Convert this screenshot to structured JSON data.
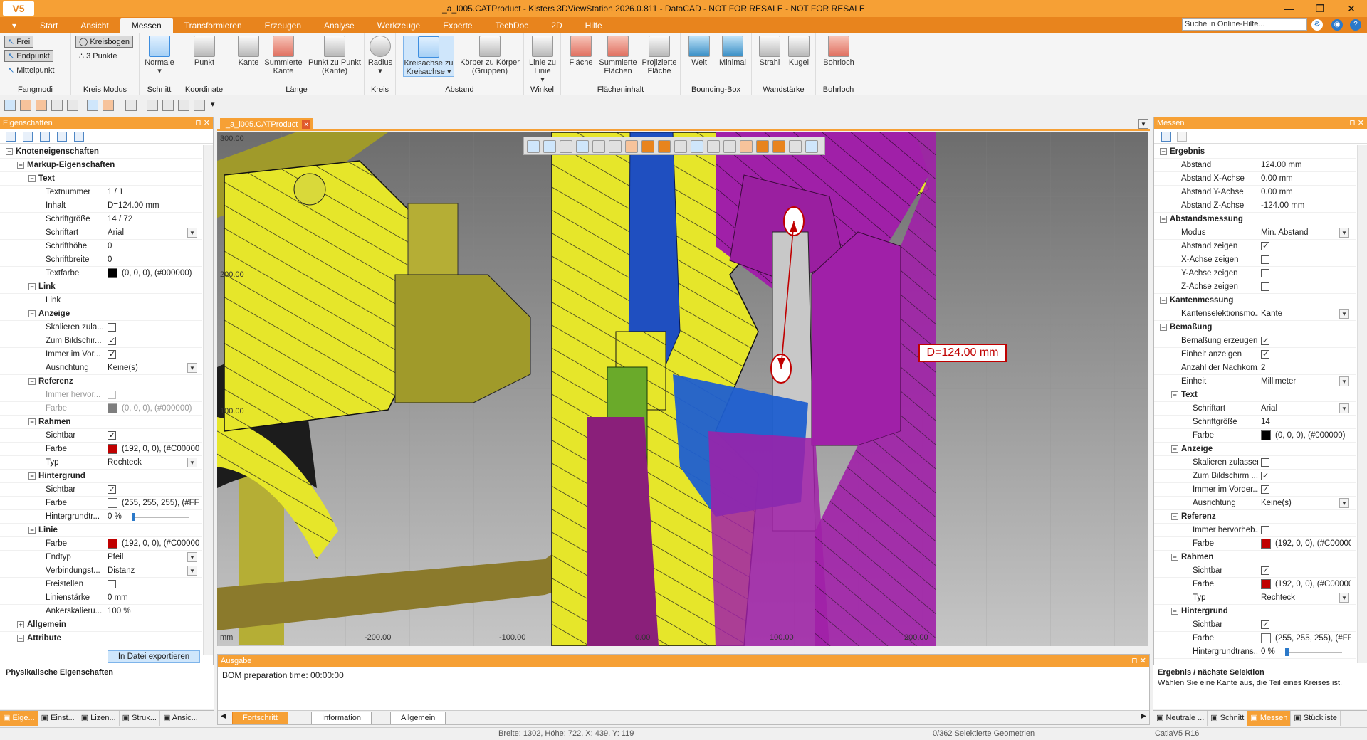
{
  "titlebar": {
    "logo": "V5",
    "title": "_a_l005.CATProduct - Kisters 3DViewStation 2026.0.811 - DataCAD - NOT FOR RESALE - NOT FOR RESALE",
    "minimize": "—",
    "restore": "❐",
    "close": "✕"
  },
  "menubar": {
    "drop": "▾",
    "tabs": [
      "Start",
      "Ansicht",
      "Messen",
      "Transformieren",
      "Erzeugen",
      "Analyse",
      "Werkzeuge",
      "Experte",
      "TechDoc",
      "2D",
      "Hilfe"
    ],
    "active_tab": "Messen",
    "help_search_placeholder": "Suche in Online-Hilfe..."
  },
  "ribbon": {
    "fangmodi": {
      "label": "Fangmodi",
      "items": [
        "Frei",
        "Endpunkt",
        "Mittelpunkt"
      ]
    },
    "kreismodus": {
      "label": "Kreis Modus",
      "items": [
        "Kreisbogen",
        "3 Punkte"
      ]
    },
    "schnitt": {
      "label": "Schnitt",
      "button": "Normale"
    },
    "koordinate": {
      "label": "Koordinate",
      "button": "Punkt"
    },
    "laenge": {
      "label": "Länge",
      "buttons": [
        "Kante",
        "Summierte Kante",
        "Punkt zu Punkt (Kante)"
      ]
    },
    "kreis": {
      "label": "Kreis",
      "button": "Radius"
    },
    "abstand": {
      "label": "Abstand",
      "buttons": [
        "Kreisachse zu Kreisachse",
        "Körper zu Körper (Gruppen)"
      ]
    },
    "winkel": {
      "label": "Winkel",
      "button": "Linie zu Linie"
    },
    "flaecheninhalt": {
      "label": "Flächeninhalt",
      "buttons": [
        "Fläche",
        "Summierte Flächen",
        "Projizierte Fläche"
      ]
    },
    "boundingbox": {
      "label": "Bounding-Box",
      "buttons": [
        "Welt",
        "Minimal"
      ]
    },
    "wandstaerke": {
      "label": "Wandstärke",
      "buttons": [
        "Strahl",
        "Kugel"
      ]
    },
    "bohrloch": {
      "label": "Bohrloch",
      "button": "Bohrloch"
    }
  },
  "left_panel": {
    "title": "Eigenschaften",
    "rows": [
      {
        "level": 0,
        "type": "cat",
        "key": "Knoteneigenschaften",
        "exp": "−"
      },
      {
        "level": 1,
        "type": "cat",
        "key": "Markup-Eigenschaften",
        "exp": "−"
      },
      {
        "level": 2,
        "type": "cat",
        "key": "Text",
        "exp": "−"
      },
      {
        "level": 3,
        "key": "Textnummer",
        "value": "1 / 1"
      },
      {
        "level": 3,
        "key": "Inhalt",
        "value": "D=124.00 mm"
      },
      {
        "level": 3,
        "key": "Schriftgröße",
        "value": "14 / 72"
      },
      {
        "level": 3,
        "key": "Schriftart",
        "value": "Arial",
        "dd": true
      },
      {
        "level": 3,
        "key": "Schrifthöhe",
        "value": "0"
      },
      {
        "level": 3,
        "key": "Schriftbreite",
        "value": "0"
      },
      {
        "level": 3,
        "key": "Textfarbe",
        "value": "(0, 0, 0), (#000000)",
        "swatch": "#000000"
      },
      {
        "level": 2,
        "type": "cat",
        "key": "Link",
        "exp": "−"
      },
      {
        "level": 3,
        "key": "Link",
        "value": ""
      },
      {
        "level": 2,
        "type": "cat",
        "key": "Anzeige",
        "exp": "−"
      },
      {
        "level": 3,
        "key": "Skalieren zula...",
        "check": false
      },
      {
        "level": 3,
        "key": "Zum Bildschir...",
        "check": true
      },
      {
        "level": 3,
        "key": "Immer im Vor...",
        "check": true
      },
      {
        "level": 3,
        "key": "Ausrichtung",
        "value": "Keine(s)",
        "dd": true
      },
      {
        "level": 2,
        "type": "cat",
        "key": "Referenz",
        "exp": "−"
      },
      {
        "level": 3,
        "key": "Immer hervor...",
        "check": false,
        "disabled": true
      },
      {
        "level": 3,
        "key": "Farbe",
        "value": "(0, 0, 0), (#000000)",
        "swatch": "#000000",
        "disabled": true
      },
      {
        "level": 2,
        "type": "cat",
        "key": "Rahmen",
        "exp": "−"
      },
      {
        "level": 3,
        "key": "Sichtbar",
        "check": true
      },
      {
        "level": 3,
        "key": "Farbe",
        "value": "(192, 0, 0), (#C00000",
        "swatch": "#c00000"
      },
      {
        "level": 3,
        "key": "Typ",
        "value": "Rechteck",
        "dd": true
      },
      {
        "level": 2,
        "type": "cat",
        "key": "Hintergrund",
        "exp": "−"
      },
      {
        "level": 3,
        "key": "Sichtbar",
        "check": true
      },
      {
        "level": 3,
        "key": "Farbe",
        "value": "(255, 255, 255), (#FFI",
        "swatch": "#ffffff"
      },
      {
        "level": 3,
        "key": "Hintergrundtr...",
        "value": "0 %",
        "slider": true
      },
      {
        "level": 2,
        "type": "cat",
        "key": "Linie",
        "exp": "−"
      },
      {
        "level": 3,
        "key": "Farbe",
        "value": "(192, 0, 0), (#C00000",
        "swatch": "#c00000"
      },
      {
        "level": 3,
        "key": "Endtyp",
        "value": "Pfeil",
        "dd": true
      },
      {
        "level": 3,
        "key": "Verbindungst...",
        "value": "Distanz",
        "dd": true
      },
      {
        "level": 3,
        "key": "Freistellen",
        "check": false
      },
      {
        "level": 3,
        "key": "Linienstärke",
        "value": "0 mm"
      },
      {
        "level": 3,
        "key": "Ankerskalieru...",
        "value": "100 %"
      },
      {
        "level": 1,
        "type": "cat",
        "key": "Allgemein",
        "exp": "+"
      },
      {
        "level": 1,
        "type": "cat",
        "key": "Attribute",
        "exp": "−"
      }
    ],
    "export_button": "In Datei exportieren",
    "bottom_title": "Physikalische Eigenschaften",
    "tabs": [
      "Eige...",
      "Einst...",
      "Lizen...",
      "Struk...",
      "Ansic..."
    ]
  },
  "viewport": {
    "doc_tab": "_a_l005.CATProduct",
    "dimension_label": "D=124.00 mm",
    "axis_labels": [
      "300.00",
      "200.00",
      "100.00",
      "mm",
      "-200.00",
      "-100.00",
      "0.00",
      "100.00",
      "200.00"
    ]
  },
  "output": {
    "title": "Ausgabe",
    "text": "BOM preparation time: 00:00:00",
    "tabs": [
      "Fortschritt",
      "Information",
      "Allgemein"
    ],
    "active_tab": "Fortschritt"
  },
  "right_panel": {
    "title": "Messen",
    "rows": [
      {
        "level": 0,
        "type": "cat",
        "key": "Ergebnis",
        "exp": "−"
      },
      {
        "level": 1,
        "key": "Abstand",
        "value": "124.00 mm"
      },
      {
        "level": 1,
        "key": "Abstand X-Achse",
        "value": "0.00 mm"
      },
      {
        "level": 1,
        "key": "Abstand Y-Achse",
        "value": "0.00 mm"
      },
      {
        "level": 1,
        "key": "Abstand Z-Achse",
        "value": "-124.00 mm"
      },
      {
        "level": 0,
        "type": "cat",
        "key": "Abstandsmessung",
        "exp": "−"
      },
      {
        "level": 1,
        "key": "Modus",
        "value": "Min. Abstand",
        "dd": true
      },
      {
        "level": 1,
        "key": "Abstand zeigen",
        "check": true
      },
      {
        "level": 1,
        "key": "X-Achse zeigen",
        "check": false
      },
      {
        "level": 1,
        "key": "Y-Achse zeigen",
        "check": false
      },
      {
        "level": 1,
        "key": "Z-Achse zeigen",
        "check": false
      },
      {
        "level": 0,
        "type": "cat",
        "key": "Kantenmessung",
        "exp": "−"
      },
      {
        "level": 1,
        "key": "Kantenselektionsmo...",
        "value": "Kante",
        "dd": true
      },
      {
        "level": 0,
        "type": "cat",
        "key": "Bemaßung",
        "exp": "−"
      },
      {
        "level": 1,
        "key": "Bemaßung erzeugen",
        "check": true
      },
      {
        "level": 1,
        "key": "Einheit anzeigen",
        "check": true
      },
      {
        "level": 1,
        "key": "Anzahl der Nachkom...",
        "value": "2"
      },
      {
        "level": 1,
        "key": "Einheit",
        "value": "Millimeter",
        "dd": true
      },
      {
        "level": 1,
        "type": "cat",
        "key": "Text",
        "exp": "−"
      },
      {
        "level": 2,
        "key": "Schriftart",
        "value": "Arial",
        "dd": true
      },
      {
        "level": 2,
        "key": "Schriftgröße",
        "value": "14"
      },
      {
        "level": 2,
        "key": "Farbe",
        "value": "(0, 0, 0), (#000000)",
        "swatch": "#000000"
      },
      {
        "level": 1,
        "type": "cat",
        "key": "Anzeige",
        "exp": "−"
      },
      {
        "level": 2,
        "key": "Skalieren zulassen",
        "check": false
      },
      {
        "level": 2,
        "key": "Zum Bildschirm ...",
        "check": true
      },
      {
        "level": 2,
        "key": "Immer im Vorder...",
        "check": true
      },
      {
        "level": 2,
        "key": "Ausrichtung",
        "value": "Keine(s)",
        "dd": true
      },
      {
        "level": 1,
        "type": "cat",
        "key": "Referenz",
        "exp": "−"
      },
      {
        "level": 2,
        "key": "Immer hervorheb...",
        "check": false
      },
      {
        "level": 2,
        "key": "Farbe",
        "value": "(192, 0, 0), (#C00000",
        "swatch": "#c00000"
      },
      {
        "level": 1,
        "type": "cat",
        "key": "Rahmen",
        "exp": "−"
      },
      {
        "level": 2,
        "key": "Sichtbar",
        "check": true
      },
      {
        "level": 2,
        "key": "Farbe",
        "value": "(192, 0, 0), (#C00000",
        "swatch": "#c00000"
      },
      {
        "level": 2,
        "key": "Typ",
        "value": "Rechteck",
        "dd": true
      },
      {
        "level": 1,
        "type": "cat",
        "key": "Hintergrund",
        "exp": "−"
      },
      {
        "level": 2,
        "key": "Sichtbar",
        "check": true
      },
      {
        "level": 2,
        "key": "Farbe",
        "value": "(255, 255, 255), (#FFI",
        "swatch": "#ffffff"
      },
      {
        "level": 2,
        "key": "Hintergrundtrans...",
        "value": "0 %",
        "slider": true
      }
    ],
    "info_title": "Ergebnis / nächste Selektion",
    "info_text": "Wählen Sie eine Kante aus, die Teil eines Kreises ist.",
    "tabs": [
      "Neutrale ...",
      "Schnitt",
      "Messen",
      "Stückliste"
    ],
    "active_tab": "Messen"
  },
  "statusbar": {
    "dims": "Breite: 1302, Höhe: 722, X: 439, Y: 119",
    "selection": "0/362 Selektierte Geometrien",
    "version": "CatiaV5 R16"
  },
  "colors": {
    "accent": "#f6a035",
    "accent_dark": "#e8841d",
    "measure_red": "#c00000"
  }
}
